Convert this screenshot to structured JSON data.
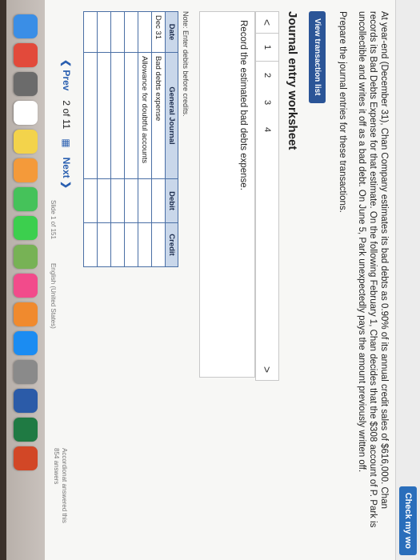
{
  "toolbar": {
    "check_label": "Check my wo"
  },
  "problem": {
    "paragraph": "At year-end (December 31), Chan Company estimates its bad debts as 0.90% of its annual credit sales of $616,000. Chan records its Bad Debts Expense for that estimate. On the following February 1, Chan decides that the $308 account of P. Park is uncollectible and writes it off as a bad debt. On June 5, Park unexpectedly pays the amount previously written off.",
    "instruction": "Prepare the journal entries for these transactions."
  },
  "buttons": {
    "view_transaction_list": "View transaction list"
  },
  "worksheet": {
    "title": "Journal entry worksheet",
    "steps": [
      "1",
      "2",
      "3",
      "4"
    ],
    "prev_arrow": "<",
    "next_arrow": ">",
    "task_text": "Record the estimated bad debts expense.",
    "note": "Note: Enter debits before credits."
  },
  "journal": {
    "headers": [
      "Date",
      "General Journal",
      "Debit",
      "Credit"
    ],
    "rows": [
      [
        "Dec 31",
        "Bad debts expense",
        "",
        ""
      ],
      [
        "",
        "Allowance for doubtful accounts",
        "",
        ""
      ],
      [
        "",
        "",
        "",
        ""
      ],
      [
        "",
        "",
        "",
        ""
      ],
      [
        "",
        "",
        "",
        ""
      ],
      [
        "",
        "",
        "",
        ""
      ]
    ]
  },
  "pager": {
    "prev": "Prev",
    "current": "2",
    "of": "of",
    "total": "11",
    "next": "Next"
  },
  "status": {
    "slide": "Slide 1 of 151",
    "language": "English (United States)"
  },
  "side": {
    "line1": "Accordionat answered this",
    "line2": "854 answers"
  },
  "dock": {
    "apps": [
      {
        "icon": "finder-icon",
        "color": "#3a8ee6"
      },
      {
        "icon": "chrome-icon",
        "color": "#e24a3b"
      },
      {
        "icon": "launchpad-icon",
        "color": "#6b6b6b"
      },
      {
        "icon": "calendar-icon",
        "color": "#ffffff"
      },
      {
        "icon": "notes-icon",
        "color": "#f3d34b"
      },
      {
        "icon": "photos-icon",
        "color": "#f49a3a"
      },
      {
        "icon": "messages-icon",
        "color": "#45c25a"
      },
      {
        "icon": "facetime-icon",
        "color": "#3ccf4e"
      },
      {
        "icon": "maps-icon",
        "color": "#77b255"
      },
      {
        "icon": "itunes-icon",
        "color": "#f24b8b"
      },
      {
        "icon": "ibooks-icon",
        "color": "#f08a2e"
      },
      {
        "icon": "appstore-icon",
        "color": "#1b8cf2"
      },
      {
        "icon": "preferences-icon",
        "color": "#8a8a8a"
      },
      {
        "icon": "word-icon",
        "color": "#2b5ba8"
      },
      {
        "icon": "excel-icon",
        "color": "#1f7a43"
      },
      {
        "icon": "powerpoint-icon",
        "color": "#d24726"
      }
    ]
  }
}
